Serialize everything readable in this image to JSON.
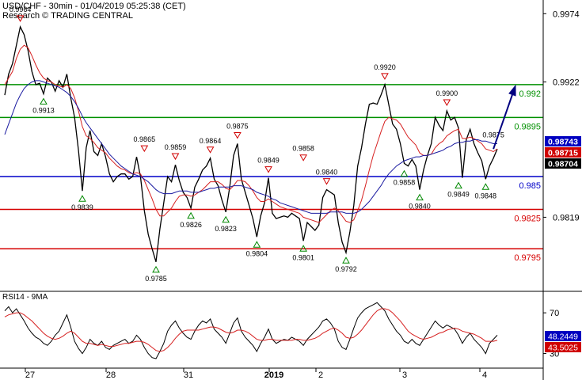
{
  "header": {
    "title": "USD/CHF - 30min - 01/04/2019 05:25:38 (CET)",
    "credit": "Research © TRADING CENTRAL"
  },
  "colors": {
    "price": "#000000",
    "ma_fast": "#d62020",
    "ma_slow": "#1a1aa0",
    "resistance": "#009000",
    "pivot": "#0000c8",
    "support": "#d60000",
    "arrow": "#000080",
    "marker_high": "#d00000",
    "marker_low": "#008800"
  },
  "chart_data": [
    {
      "type": "line",
      "title": "USD/CHF - 30min - 01/04/2019 05:25:38 (CET)",
      "x_labels": [
        "27",
        "28",
        "31",
        "2019",
        "2",
        "3",
        "4"
      ],
      "y_ticks": [
        "0.9974",
        "0.9922",
        "0.9819"
      ],
      "ylim": [
        0.9765,
        0.9982
      ],
      "grid": false,
      "series": [
        {
          "role": "price",
          "values": [
            0.9912,
            0.9928,
            0.9936,
            0.995,
            0.9964,
            0.9958,
            0.9946,
            0.993,
            0.992,
            0.9921,
            0.9913,
            0.9925,
            0.9922,
            0.9915,
            0.9923,
            0.9918,
            0.9928,
            0.991,
            0.9895,
            0.987,
            0.9839,
            0.9872,
            0.9885,
            0.9869,
            0.9866,
            0.9875,
            0.9865,
            0.9852,
            0.9846,
            0.985,
            0.9852,
            0.9852,
            0.9848,
            0.985,
            0.9865,
            0.985,
            0.9824,
            0.9806,
            0.9795,
            0.9785,
            0.981,
            0.983,
            0.985,
            0.9846,
            0.9859,
            0.9847,
            0.9838,
            0.9834,
            0.9826,
            0.9842,
            0.9848,
            0.9855,
            0.9858,
            0.9864,
            0.9848,
            0.9843,
            0.9832,
            0.9823,
            0.9842,
            0.9866,
            0.9875,
            0.9848,
            0.9838,
            0.9828,
            0.9818,
            0.9804,
            0.982,
            0.983,
            0.9849,
            0.9822,
            0.9818,
            0.9819,
            0.982,
            0.9819,
            0.9822,
            0.982,
            0.9818,
            0.9801,
            0.9815,
            0.9812,
            0.9809,
            0.9813,
            0.9834,
            0.984,
            0.9838,
            0.9836,
            0.9815,
            0.98,
            0.9792,
            0.9808,
            0.9828,
            0.9858,
            0.9872,
            0.989,
            0.9905,
            0.9906,
            0.9905,
            0.9912,
            0.992,
            0.9905,
            0.989,
            0.9886,
            0.9875,
            0.986,
            0.9858,
            0.9863,
            0.9858,
            0.984,
            0.9855,
            0.9866,
            0.9875,
            0.9895,
            0.9889,
            0.9885,
            0.99,
            0.9893,
            0.9895,
            0.9887,
            0.9849,
            0.9878,
            0.9886,
            0.9875,
            0.9868,
            0.9862,
            0.9848,
            0.9858,
            0.9864,
            0.9871
          ]
        },
        {
          "role": "ma_fast",
          "values": [
            0.992,
            0.9925,
            0.993,
            0.994,
            0.9947,
            0.995,
            0.9948,
            0.9942,
            0.9935,
            0.9929,
            0.9925,
            0.9923,
            0.9922,
            0.992,
            0.9919,
            0.9918,
            0.992,
            0.9917,
            0.991,
            0.99,
            0.9888,
            0.9881,
            0.9879,
            0.9876,
            0.9872,
            0.987,
            0.9868,
            0.9864,
            0.9861,
            0.9858,
            0.9856,
            0.9855,
            0.9853,
            0.9852,
            0.9853,
            0.9852,
            0.9847,
            0.984,
            0.9833,
            0.9825,
            0.982,
            0.982,
            0.9823,
            0.9826,
            0.9831,
            0.9835,
            0.9836,
            0.9836,
            0.9835,
            0.9836,
            0.9838,
            0.984,
            0.9843,
            0.9846,
            0.9846,
            0.9846,
            0.9844,
            0.9841,
            0.984,
            0.9843,
            0.9847,
            0.9847,
            0.9846,
            0.9843,
            0.9839,
            0.9834,
            0.9831,
            0.9831,
            0.9833,
            0.9831,
            0.9829,
            0.9827,
            0.9826,
            0.9825,
            0.9824,
            0.9823,
            0.9822,
            0.9819,
            0.9818,
            0.9817,
            0.9816,
            0.9815,
            0.9818,
            0.9821,
            0.9824,
            0.9826,
            0.9824,
            0.982,
            0.9816,
            0.9815,
            0.9817,
            0.9824,
            0.9832,
            0.9843,
            0.9855,
            0.9866,
            0.9875,
            0.9884,
            0.9892,
            0.9895,
            0.9894,
            0.9893,
            0.989,
            0.9885,
            0.988,
            0.9877,
            0.9874,
            0.9868,
            0.9866,
            0.9866,
            0.9867,
            0.9872,
            0.9875,
            0.9877,
            0.9881,
            0.9883,
            0.9885,
            0.9886,
            0.9879,
            0.9879,
            0.988,
            0.9879,
            0.9877,
            0.9875,
            0.9871,
            0.987,
            0.9869,
            0.9871
          ]
        },
        {
          "role": "ma_slow",
          "values": [
            0.9882,
            0.989,
            0.9898,
            0.9906,
            0.9912,
            0.9917,
            0.992,
            0.9922,
            0.9923,
            0.9923,
            0.9922,
            0.9921,
            0.992,
            0.9919,
            0.9918,
            0.9916,
            0.9914,
            0.9911,
            0.9907,
            0.9902,
            0.9896,
            0.9891,
            0.9887,
            0.9883,
            0.9879,
            0.9875,
            0.9871,
            0.9867,
            0.9864,
            0.9861,
            0.9858,
            0.9856,
            0.9854,
            0.9852,
            0.9851,
            0.985,
            0.9848,
            0.9846,
            0.9843,
            0.984,
            0.9838,
            0.9837,
            0.9837,
            0.9837,
            0.9838,
            0.9839,
            0.9839,
            0.9839,
            0.9838,
            0.9838,
            0.9838,
            0.9839,
            0.984,
            0.9841,
            0.9841,
            0.9842,
            0.9842,
            0.9842,
            0.9842,
            0.9843,
            0.9843,
            0.9843,
            0.9842,
            0.9841,
            0.984,
            0.9838,
            0.9837,
            0.9836,
            0.9835,
            0.9833,
            0.9832,
            0.983,
            0.9829,
            0.9828,
            0.9827,
            0.9826,
            0.9825,
            0.9824,
            0.9823,
            0.9822,
            0.9822,
            0.9822,
            0.9822,
            0.9822,
            0.9823,
            0.9823,
            0.9823,
            0.9823,
            0.9822,
            0.9822,
            0.9822,
            0.9823,
            0.9825,
            0.9828,
            0.9831,
            0.9835,
            0.9839,
            0.9843,
            0.9848,
            0.9852,
            0.9855,
            0.9858,
            0.986,
            0.9862,
            0.9863,
            0.9864,
            0.9865,
            0.9865,
            0.9866,
            0.9866,
            0.9867,
            0.9868,
            0.9869,
            0.987,
            0.9872,
            0.9873,
            0.9875,
            0.9876,
            0.9876,
            0.9877,
            0.9877,
            0.9878,
            0.9878,
            0.9877,
            0.9877,
            0.9876,
            0.9875,
            0.9875
          ]
        }
      ],
      "levels": [
        {
          "kind": "resistance",
          "value": 0.992,
          "label": "0.992"
        },
        {
          "kind": "resistance",
          "value": 0.9895,
          "label": "0.9895"
        },
        {
          "kind": "pivot",
          "value": 0.985,
          "label": "0.985"
        },
        {
          "kind": "support",
          "value": 0.9825,
          "label": "0.9825"
        },
        {
          "kind": "support",
          "value": 0.9795,
          "label": "0.9795"
        }
      ],
      "price_tags": [
        {
          "label": "0.98743",
          "value": 0.98743,
          "color": "#0000c0"
        },
        {
          "label": "0.98715",
          "value": 0.98715,
          "color": "#d00000"
        },
        {
          "label": "0.98704",
          "value": 0.98704,
          "color": "#000000"
        }
      ],
      "projection": [
        [
          126,
          0.9871
        ],
        [
          132,
          0.9922
        ]
      ],
      "markers": [
        {
          "i": 4,
          "value": 0.9964,
          "kind": "high",
          "label": "0.9964"
        },
        {
          "i": 10,
          "value": 0.9913,
          "kind": "low",
          "label": "0.9913"
        },
        {
          "i": 20,
          "value": 0.9839,
          "kind": "low",
          "label": "0.9839"
        },
        {
          "i": 36,
          "value": 0.9865,
          "kind": "high",
          "label": "0.9865"
        },
        {
          "i": 39,
          "value": 0.9785,
          "kind": "low",
          "label": "0.9785"
        },
        {
          "i": 44,
          "value": 0.9859,
          "kind": "high",
          "label": "0.9859"
        },
        {
          "i": 48,
          "value": 0.9826,
          "kind": "low",
          "label": "0.9826"
        },
        {
          "i": 53,
          "value": 0.9864,
          "kind": "high",
          "label": "0.9864"
        },
        {
          "i": 57,
          "value": 0.9823,
          "kind": "low",
          "label": "0.9823"
        },
        {
          "i": 60,
          "value": 0.9875,
          "kind": "high",
          "label": "0.9875"
        },
        {
          "i": 65,
          "value": 0.9804,
          "kind": "low",
          "label": "0.9804"
        },
        {
          "i": 68,
          "value": 0.9849,
          "kind": "high",
          "label": "0.9849"
        },
        {
          "i": 77,
          "value": 0.9801,
          "kind": "low",
          "label": "0.9801"
        },
        {
          "i": 77,
          "value": 0.9858,
          "kind": "high",
          "label": "0.9858"
        },
        {
          "i": 83,
          "value": 0.984,
          "kind": "high",
          "label": "0.9840"
        },
        {
          "i": 88,
          "value": 0.9792,
          "kind": "low",
          "label": "0.9792"
        },
        {
          "i": 98,
          "value": 0.992,
          "kind": "high",
          "label": "0.9920"
        },
        {
          "i": 103,
          "value": 0.9858,
          "kind": "low",
          "label": "0.9858"
        },
        {
          "i": 107,
          "value": 0.984,
          "kind": "low",
          "label": "0.9840"
        },
        {
          "i": 114,
          "value": 0.99,
          "kind": "high",
          "label": "0.9900"
        },
        {
          "i": 117,
          "value": 0.9849,
          "kind": "low",
          "label": "0.9849"
        },
        {
          "i": 124,
          "value": 0.9848,
          "kind": "low",
          "label": "0.9848"
        },
        {
          "i": 126,
          "value": 0.9875,
          "kind": "label",
          "label": "0.9875"
        }
      ]
    },
    {
      "type": "line",
      "title": "RSI14 - 9MA",
      "y_ticks": [
        "70",
        "30"
      ],
      "ylim": [
        18,
        88
      ],
      "series": [
        {
          "role": "rsi",
          "values": [
            72,
            76,
            70,
            74,
            68,
            62,
            55,
            50,
            46,
            44,
            40,
            38,
            42,
            48,
            52,
            60,
            68,
            56,
            42,
            35,
            30,
            36,
            44,
            40,
            38,
            42,
            36,
            34,
            38,
            40,
            42,
            44,
            40,
            42,
            48,
            44,
            36,
            30,
            26,
            25,
            32,
            40,
            52,
            58,
            62,
            55,
            50,
            46,
            44,
            52,
            58,
            62,
            60,
            64,
            54,
            50,
            46,
            40,
            50,
            60,
            65,
            52,
            46,
            42,
            38,
            32,
            40,
            46,
            54,
            44,
            40,
            42,
            44,
            43,
            46,
            44,
            42,
            38,
            44,
            48,
            52,
            56,
            62,
            64,
            60,
            54,
            42,
            36,
            34,
            44,
            55,
            65,
            70,
            74,
            76,
            78,
            80,
            76,
            72,
            64,
            58,
            52,
            48,
            42,
            40,
            44,
            40,
            38,
            44,
            50,
            56,
            62,
            58,
            55,
            58,
            56,
            54,
            48,
            40,
            46,
            50,
            44,
            40,
            36,
            30,
            40,
            44,
            48
          ]
        },
        {
          "role": "rsi_ma",
          "values": [
            66,
            68,
            69,
            70,
            70,
            68,
            65,
            62,
            58,
            54,
            50,
            47,
            45,
            44,
            45,
            47,
            50,
            52,
            50,
            46,
            42,
            40,
            40,
            39,
            38,
            39,
            38,
            37,
            37,
            38,
            39,
            40,
            40,
            41,
            42,
            42,
            41,
            39,
            36,
            33,
            32,
            33,
            36,
            40,
            45,
            49,
            52,
            53,
            53,
            53,
            53,
            54,
            55,
            56,
            56,
            55,
            53,
            51,
            50,
            51,
            53,
            53,
            52,
            50,
            47,
            44,
            43,
            43,
            44,
            44,
            43,
            43,
            43,
            43,
            43,
            44,
            44,
            43,
            43,
            44,
            45,
            47,
            50,
            52,
            54,
            55,
            53,
            50,
            46,
            45,
            46,
            49,
            53,
            58,
            63,
            68,
            72,
            74,
            74,
            73,
            70,
            66,
            62,
            57,
            52,
            49,
            47,
            45,
            44,
            45,
            46,
            48,
            50,
            51,
            53,
            54,
            55,
            54,
            52,
            51,
            50,
            49,
            47,
            45,
            42,
            42,
            42,
            43
          ]
        }
      ],
      "value_tags": [
        {
          "label": "48.2449",
          "value": 48.2449,
          "color": "#0000c0"
        },
        {
          "label": "43.5025",
          "value": 43.5025,
          "color": "#d00000"
        }
      ]
    }
  ]
}
